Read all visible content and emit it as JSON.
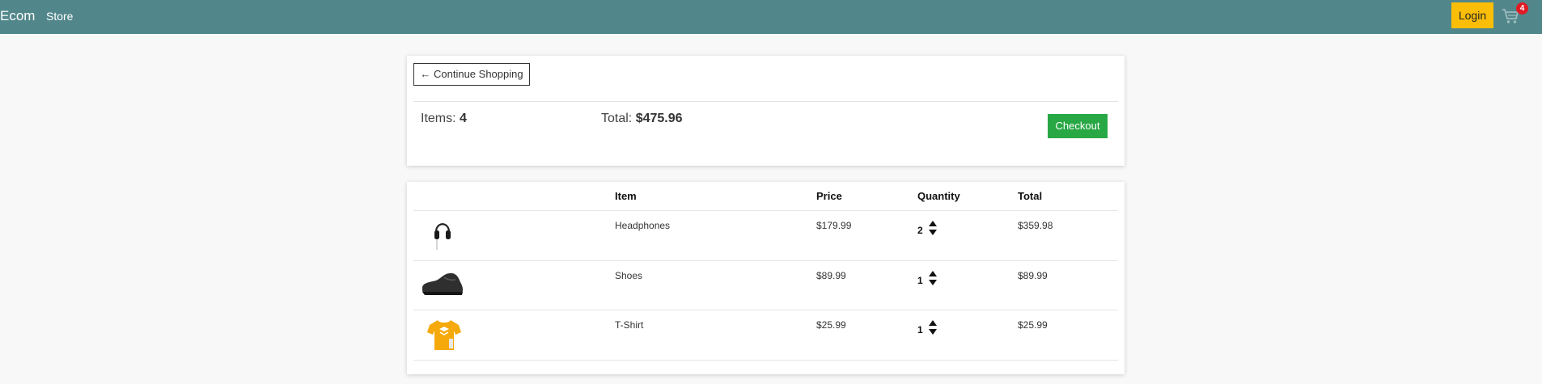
{
  "navbar": {
    "brand": "Ecom",
    "store_link": "Store",
    "login_label": "Login",
    "cart_count": "4",
    "cart_icon": "cart-icon",
    "background": "#51878b",
    "login_color": "#fbbe08"
  },
  "summary": {
    "continue_label": "← Continue Shopping",
    "items_prefix": "Items: ",
    "items_count": "4",
    "total_prefix": "Total: ",
    "total_value": "$475.96",
    "checkout_label": "Checkout",
    "checkout_color": "#28a745"
  },
  "table": {
    "headers": [
      "",
      "Item",
      "Price",
      "Quantity",
      "Total"
    ],
    "rows": [
      {
        "image": "headphones-image",
        "item": "Headphones",
        "price": "$179.99",
        "quantity": "2",
        "total": "$359.98"
      },
      {
        "image": "shoes-image",
        "item": "Shoes",
        "price": "$89.99",
        "quantity": "1",
        "total": "$89.99"
      },
      {
        "image": "tshirt-image",
        "item": "T-Shirt",
        "price": "$25.99",
        "quantity": "1",
        "total": "$25.99"
      }
    ]
  }
}
